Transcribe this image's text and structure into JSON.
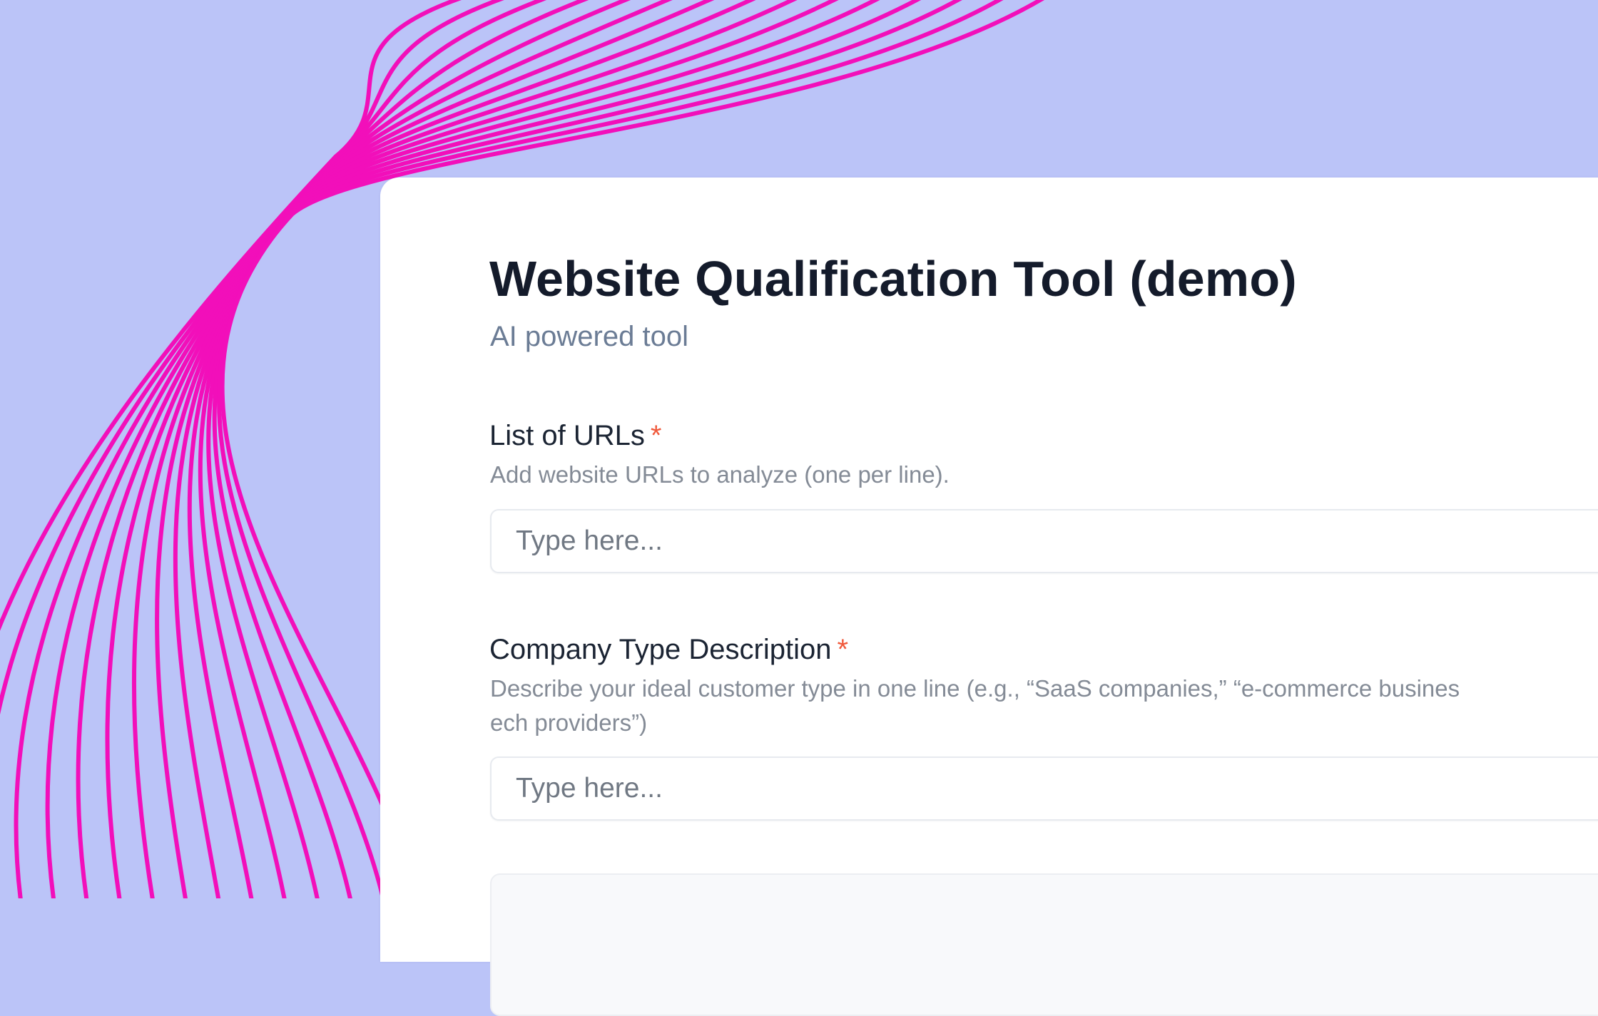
{
  "background": {
    "color": "#bbc4f8",
    "wave_color": "#f20fba"
  },
  "form": {
    "title": "Website Qualification Tool (demo)",
    "subtitle": "AI powered tool",
    "required_marker": "*",
    "fields": [
      {
        "label": "List of URLs",
        "help": "Add website URLs to analyze (one per line).",
        "help_line2": "",
        "placeholder": "Type here..."
      },
      {
        "label": "Company Type Description",
        "help": "Describe your ideal customer type in one line (e.g., “SaaS companies,” “e-commerce busines",
        "help_line2": "ech providers”)",
        "placeholder": "Type here..."
      }
    ]
  },
  "colors": {
    "title": "#141b2b",
    "subtitle": "#6b7c95",
    "required": "#f0593b",
    "help_text": "#848b96"
  }
}
